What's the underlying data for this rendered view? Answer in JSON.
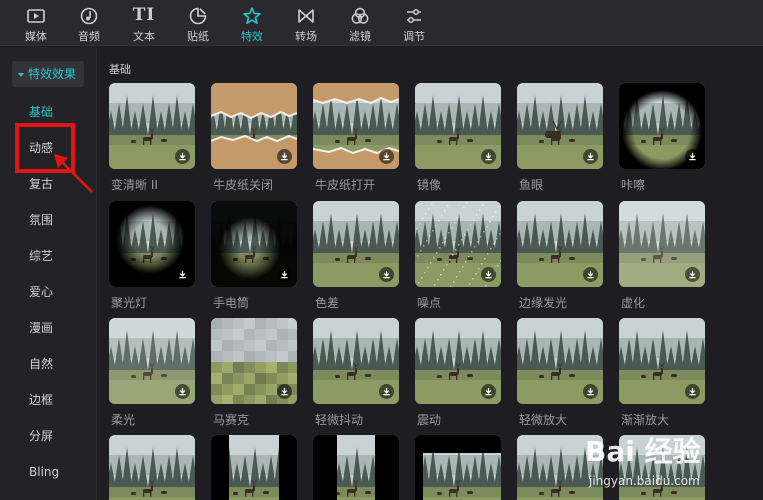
{
  "toolbar": {
    "items": [
      {
        "label": "媒体",
        "icon": "media-icon"
      },
      {
        "label": "音频",
        "icon": "audio-icon"
      },
      {
        "label": "文本",
        "icon": "text-icon",
        "glyph": "TI"
      },
      {
        "label": "贴纸",
        "icon": "sticker-icon"
      },
      {
        "label": "特效",
        "icon": "effects-icon"
      },
      {
        "label": "转场",
        "icon": "transition-icon"
      },
      {
        "label": "滤镜",
        "icon": "filter-icon"
      },
      {
        "label": "调节",
        "icon": "adjust-icon"
      }
    ],
    "active": "特效",
    "accent": "#27c7c7"
  },
  "sidebar": {
    "section": "特效效果",
    "categories": [
      "基础",
      "动感",
      "复古",
      "氛围",
      "综艺",
      "爱心",
      "漫画",
      "自然",
      "边框",
      "分屏",
      "Bling"
    ],
    "active": "基础"
  },
  "annotation_color": "#e51414",
  "main": {
    "section_label": "基础",
    "effects": [
      {
        "label": "变清晰 II",
        "style": "clear"
      },
      {
        "label": "牛皮纸关闭",
        "style": "paper-close"
      },
      {
        "label": "牛皮纸打开",
        "style": "paper-open"
      },
      {
        "label": "镜像",
        "style": "normal"
      },
      {
        "label": "鱼眼",
        "style": "fisheye"
      },
      {
        "label": "咔嚓",
        "style": "flash"
      },
      {
        "label": "聚光灯",
        "style": "spotlight"
      },
      {
        "label": "手电筒",
        "style": "flashlight"
      },
      {
        "label": "色差",
        "style": "normal"
      },
      {
        "label": "噪点",
        "style": "noise"
      },
      {
        "label": "边缘发光",
        "style": "normal"
      },
      {
        "label": "虚化",
        "style": "blur"
      },
      {
        "label": "柔光",
        "style": "soft"
      },
      {
        "label": "马赛克",
        "style": "mosaic"
      },
      {
        "label": "轻微抖动",
        "style": "normal"
      },
      {
        "label": "震动",
        "style": "normal"
      },
      {
        "label": "轻微放大",
        "style": "normal"
      },
      {
        "label": "渐渐放大",
        "style": "zoom"
      },
      {
        "label": "",
        "style": "partial"
      },
      {
        "label": "",
        "style": "bars-v"
      },
      {
        "label": "",
        "style": "bars-narrow"
      },
      {
        "label": "",
        "style": "letterbox"
      },
      {
        "label": "",
        "style": "partial"
      },
      {
        "label": "",
        "style": "partial"
      }
    ]
  },
  "watermark": {
    "logo": "Bai 经验",
    "url": "jingyan.baidu.com"
  }
}
